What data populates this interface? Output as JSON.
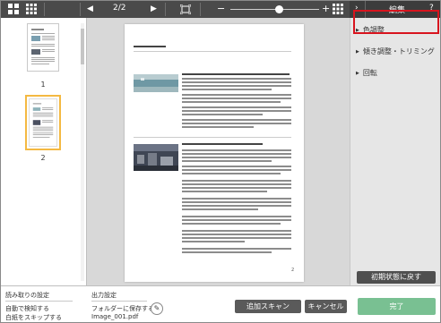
{
  "toolbar": {
    "page_indicator": "2/2",
    "zoom_value": 0.55
  },
  "right_header": {
    "title": "編集",
    "help": "?"
  },
  "thumbnails": {
    "items": [
      {
        "number": "1"
      },
      {
        "number": "2"
      }
    ],
    "selected_index": 1
  },
  "panel": {
    "items": [
      {
        "label": "色調整"
      },
      {
        "label": "傾き調整・トリミング"
      },
      {
        "label": "回転"
      }
    ],
    "reset_label": "初期状態に戻す"
  },
  "bottom": {
    "read_settings_title": "読み取りの設定",
    "read_settings_line1": "自動で検知する",
    "read_settings_line2": "白紙をスキップする",
    "output_title": "出力設定",
    "output_line1": "フォルダーに保存する",
    "output_line2": "Image_001.pdf",
    "add_scan_label": "追加スキャン",
    "cancel_label": "キャンセル",
    "done_label": "完了"
  },
  "document": {
    "page_number": "2"
  },
  "colors": {
    "toolbar_bg": "#4a4a4a",
    "panel_bg": "#e6e6e6",
    "selected_thumb_border": "#f4b942",
    "done_bg": "#79c092",
    "done_highlight": "#d8141e"
  }
}
